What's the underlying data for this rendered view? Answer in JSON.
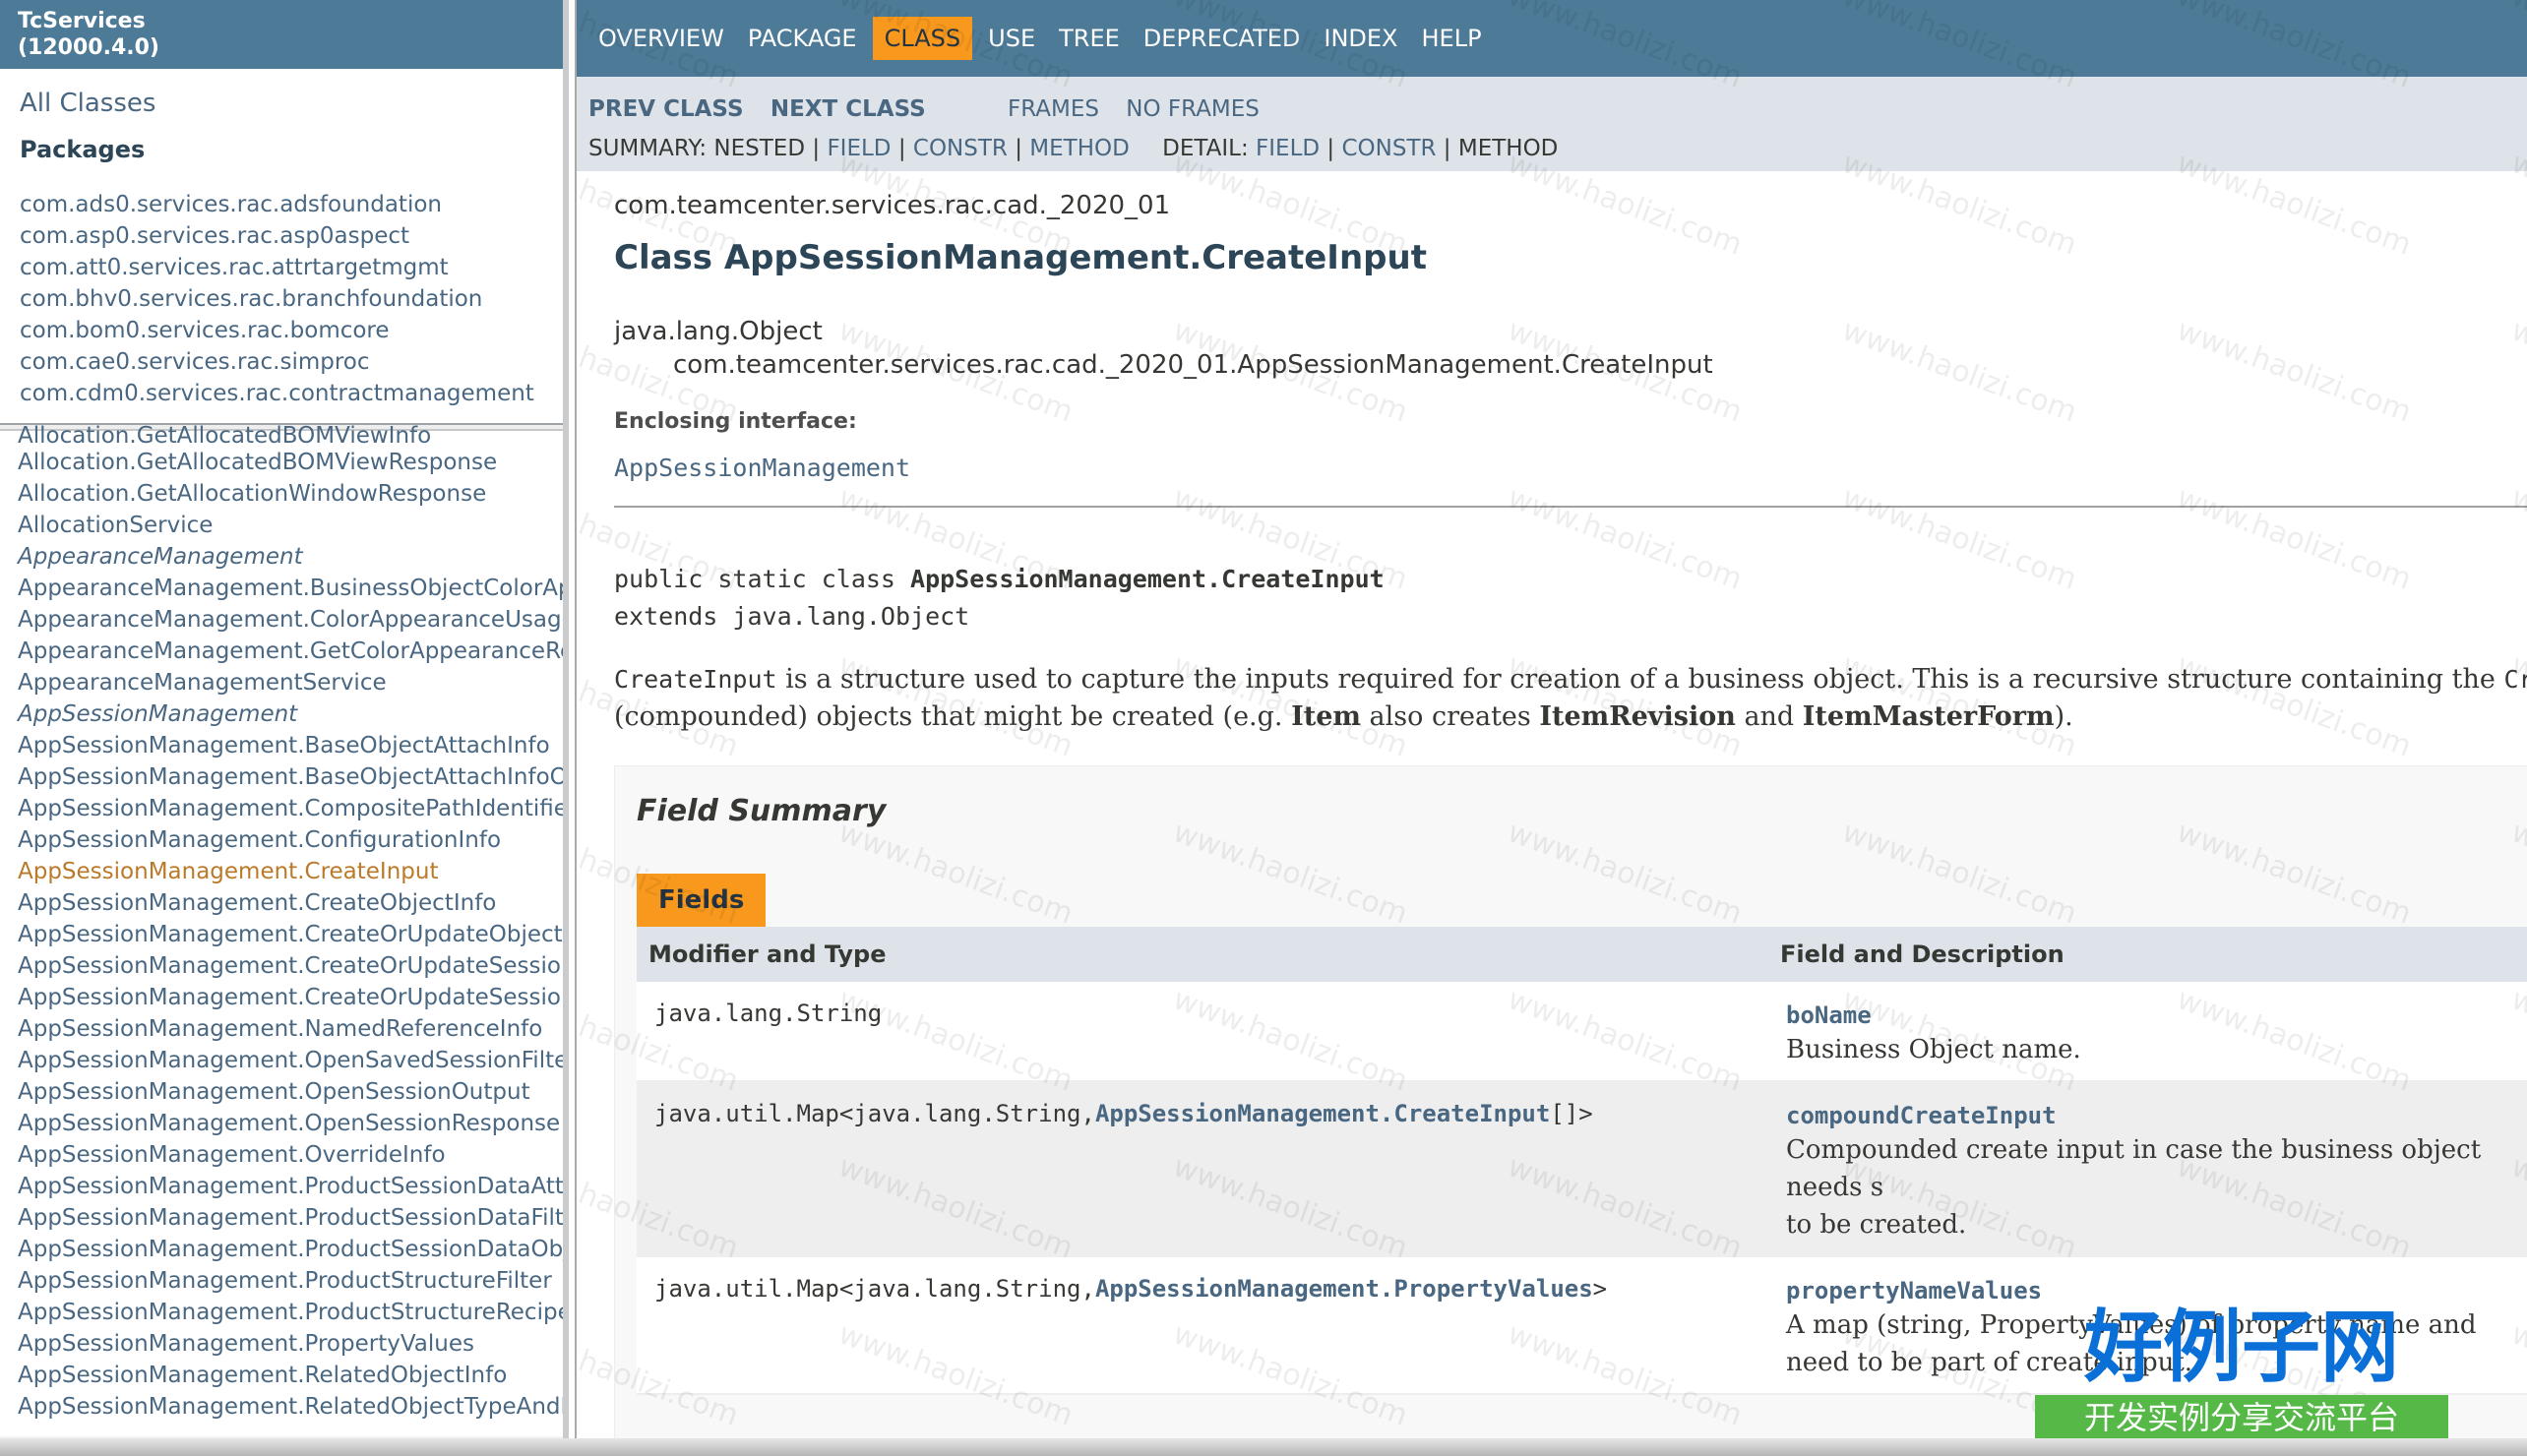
{
  "left_top": {
    "title_line1": "TcServices",
    "title_line2": "(12000.4.0)",
    "all_classes": "All Classes",
    "packages_heading": "Packages",
    "packages": [
      "com.ads0.services.rac.adsfoundation",
      "com.asp0.services.rac.asp0aspect",
      "com.att0.services.rac.attrtargetmgmt",
      "com.bhv0.services.rac.branchfoundation",
      "com.bom0.services.rac.bomcore",
      "com.cae0.services.rac.simproc",
      "com.cdm0.services.rac.contractmanagement"
    ]
  },
  "left_bottom": {
    "classes": [
      {
        "label": "Allocation.GetAllocatedBOMViewInfo",
        "style": "first"
      },
      {
        "label": "Allocation.GetAllocatedBOMViewResponse",
        "style": ""
      },
      {
        "label": "Allocation.GetAllocationWindowResponse",
        "style": ""
      },
      {
        "label": "AllocationService",
        "style": ""
      },
      {
        "label": "AppearanceManagement",
        "style": "it"
      },
      {
        "label": "AppearanceManagement.BusinessObjectColorAppe",
        "style": ""
      },
      {
        "label": "AppearanceManagement.ColorAppearanceUsage",
        "style": ""
      },
      {
        "label": "AppearanceManagement.GetColorAppearanceResp",
        "style": ""
      },
      {
        "label": "AppearanceManagementService",
        "style": ""
      },
      {
        "label": "AppSessionManagement",
        "style": "it"
      },
      {
        "label": "AppSessionManagement.BaseObjectAttachInfo",
        "style": ""
      },
      {
        "label": "AppSessionManagement.BaseObjectAttachInfoOutp",
        "style": ""
      },
      {
        "label": "AppSessionManagement.CompositePathIdentifiers",
        "style": ""
      },
      {
        "label": "AppSessionManagement.ConfigurationInfo",
        "style": ""
      },
      {
        "label": "AppSessionManagement.CreateInput",
        "style": "sel"
      },
      {
        "label": "AppSessionManagement.CreateObjectInfo",
        "style": ""
      },
      {
        "label": "AppSessionManagement.CreateOrUpdateObjectInfo",
        "style": ""
      },
      {
        "label": "AppSessionManagement.CreateOrUpdateSessionO",
        "style": ""
      },
      {
        "label": "AppSessionManagement.CreateOrUpdateSessionR",
        "style": ""
      },
      {
        "label": "AppSessionManagement.NamedReferenceInfo",
        "style": ""
      },
      {
        "label": "AppSessionManagement.OpenSavedSessionFilter",
        "style": ""
      },
      {
        "label": "AppSessionManagement.OpenSessionOutput",
        "style": ""
      },
      {
        "label": "AppSessionManagement.OpenSessionResponse",
        "style": ""
      },
      {
        "label": "AppSessionManagement.OverrideInfo",
        "style": ""
      },
      {
        "label": "AppSessionManagement.ProductSessionDataAttach",
        "style": ""
      },
      {
        "label": "AppSessionManagement.ProductSessionDataFilter",
        "style": ""
      },
      {
        "label": "AppSessionManagement.ProductSessionDataObjec",
        "style": ""
      },
      {
        "label": "AppSessionManagement.ProductStructureFilter",
        "style": ""
      },
      {
        "label": "AppSessionManagement.ProductStructureRecipe",
        "style": ""
      },
      {
        "label": "AppSessionManagement.PropertyValues",
        "style": ""
      },
      {
        "label": "AppSessionManagement.RelatedObjectInfo",
        "style": ""
      },
      {
        "label": "AppSessionManagement.RelatedObjectTypeAndNa",
        "style": ""
      }
    ]
  },
  "topnav": {
    "items": [
      "OVERVIEW",
      "PACKAGE",
      "CLASS",
      "USE",
      "TREE",
      "DEPRECATED",
      "INDEX",
      "HELP"
    ],
    "active": "CLASS"
  },
  "subnav": {
    "prev_class": "PREV CLASS",
    "next_class": "NEXT CLASS",
    "frames": "FRAMES",
    "no_frames": "NO FRAMES",
    "summary_label": "SUMMARY: NESTED |",
    "summary_field": "FIELD",
    "summary_constr": "CONSTR",
    "summary_method": "METHOD",
    "detail_label": "DETAIL:",
    "detail_field": "FIELD",
    "detail_constr": "CONSTR",
    "detail_method": "METHOD",
    "sep": "|"
  },
  "content": {
    "package_name": "com.teamcenter.services.rac.cad._2020_01",
    "class_title": "Class AppSessionManagement.CreateInput",
    "inherit_root": "java.lang.Object",
    "inherit_child": "com.teamcenter.services.rac.cad._2020_01.AppSessionManagement.CreateInput",
    "enclosing_label": "Enclosing interface:",
    "enclosing_link": "AppSessionManagement",
    "decl_prefix": "public static class ",
    "decl_name": "AppSessionManagement.CreateInput",
    "decl_extends": "extends java.lang.Object",
    "desc_code1": "CreateInput",
    "desc_text1": " is a structure used to capture the inputs required for creation of a business object. This is a recursive structure containing the ",
    "desc_code2": "CreateInput(s",
    "desc_text2": "(compounded) objects that might be created (e.g. ",
    "desc_b1": "Item",
    "desc_text3": " also creates ",
    "desc_b2": "ItemRevision",
    "desc_text4": " and ",
    "desc_b3": "ItemMasterForm",
    "desc_text5": ")."
  },
  "field_summary": {
    "title": "Field Summary",
    "tab": "Fields",
    "col1": "Modifier and Type",
    "col2": "Field and Description",
    "rows": [
      {
        "type_pre": "java.lang.String",
        "type_link": "",
        "type_post": "",
        "name": "boName",
        "desc": "Business Object name."
      },
      {
        "type_pre": "java.util.Map<java.lang.String,",
        "type_link": "AppSessionManagement.CreateInput",
        "type_post": "[]>",
        "name": "compoundCreateInput",
        "desc": "Compounded create input in case the business object needs s",
        "desc2": "to be created."
      },
      {
        "type_pre": "java.util.Map<java.lang.String,",
        "type_link": "AppSessionManagement.PropertyValues",
        "type_post": ">",
        "name": "propertyNameValues",
        "desc": "A map (string, PropertyValues) of property name and",
        "desc2": "need to be part of create input."
      }
    ]
  },
  "watermark": {
    "text": "www.haolizi.com",
    "logo_main": "好例子网",
    "logo_sub": "开发实例分享交流平台"
  }
}
